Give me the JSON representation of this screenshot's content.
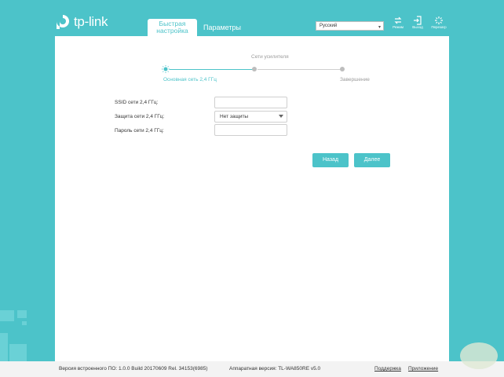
{
  "brand": {
    "logo_text": "tp-link"
  },
  "tabs": [
    {
      "label": "Быстрая настройка",
      "active": true
    },
    {
      "label": "Параметры",
      "active": false
    }
  ],
  "language": {
    "selected": "Русский"
  },
  "header_actions": [
    {
      "label": "Режим",
      "icon": "mode-icon"
    },
    {
      "label": "Выход",
      "icon": "logout-icon"
    },
    {
      "label": "Перезагр",
      "icon": "reboot-icon"
    }
  ],
  "progress": {
    "steps": [
      {
        "label": "Основная сеть 2,4 ГГц",
        "active": true
      },
      {
        "label": "Сети усилителя",
        "active": false
      },
      {
        "label": "Завершение",
        "active": false
      }
    ]
  },
  "form": {
    "ssid_label": "SSID сети 2,4 ГГц:",
    "ssid_value": "",
    "security_label": "Защита сети 2,4 ГГц:",
    "security_value": "Нет защиты",
    "password_label": "Пароль сети 2,4 ГГц:",
    "password_value": ""
  },
  "buttons": {
    "back": "Назад",
    "next": "Далее"
  },
  "footer": {
    "firmware": "Версия встроенного ПО: 1.0.0 Build 20170609 Rel. 34153(6985)",
    "hardware": "Аппаратная версия: TL-WA850RE v5.0",
    "support": "Поддержка",
    "app": "Приложение"
  },
  "colors": {
    "accent": "#4cc3c9",
    "panel": "#ffffff",
    "footer": "#f3f3f3"
  }
}
